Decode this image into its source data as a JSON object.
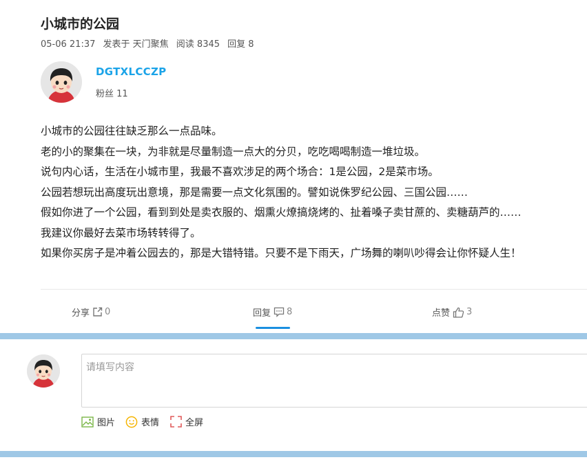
{
  "post": {
    "title": "小城市的公园",
    "date": "05-06 21:37",
    "posted_in": "发表于 天门聚焦",
    "reads": "阅读 8345",
    "replies": "回复 8"
  },
  "author": {
    "name": "DGTXLCCZP",
    "fans": "粉丝 11"
  },
  "content": [
    "小城市的公园往往缺乏那么一点品味。",
    "老的小的聚集在一块，为非就是尽量制造一点大的分贝，吃吃喝喝制造一堆垃圾。",
    "说句内心话，生活在小城市里，我最不喜欢涉足的两个场合：1是公园，2是菜市场。",
    "公园若想玩出高度玩出意境，那是需要一点文化氛围的。譬如说侏罗纪公园、三国公园……",
    "假如你进了一个公园，看到到处是卖衣服的、烟熏火燎搞烧烤的、扯着嗓子卖甘蔗的、卖糖葫芦的……",
    "我建议你最好去菜市场转转得了。",
    "如果你买房子是冲着公园去的，那是大错特错。只要不是下雨天，广场舞的喇叭吵得会让你怀疑人生！"
  ],
  "actions": {
    "share_label": "分享",
    "share_count": "0",
    "reply_label": "回复",
    "reply_count": "8",
    "like_label": "点赞",
    "like_count": "3"
  },
  "comment": {
    "placeholder": "请填写内容",
    "image_label": "图片",
    "emoji_label": "表情",
    "fullscreen_label": "全屏"
  },
  "colors": {
    "accent": "#1aa3e8",
    "active_tab": "#1a8fe0",
    "band": "#9fc8e6",
    "image_icon": "#7ab648",
    "emoji_icon": "#f5b400",
    "fullscreen_icon": "#e05a5a"
  },
  "icons": {
    "share": "share-icon",
    "reply": "comment-icon",
    "like": "thumbs-up-icon",
    "image": "image-icon",
    "emoji": "smiley-icon",
    "fullscreen": "fullscreen-icon"
  }
}
